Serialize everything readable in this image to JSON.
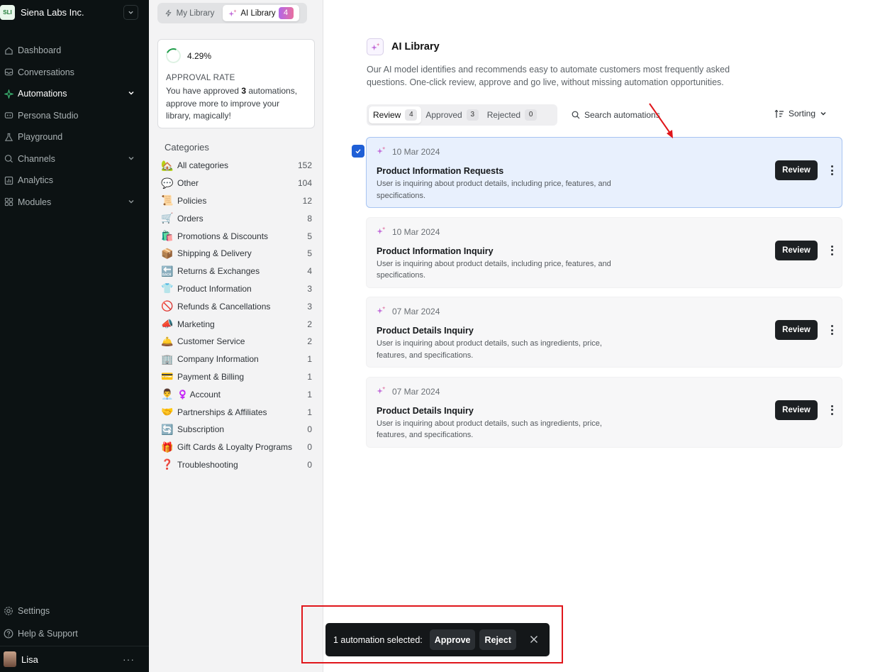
{
  "workspace": {
    "logo_text": "SLI",
    "name": "Siena Labs Inc."
  },
  "nav": {
    "items": [
      {
        "label": "Dashboard",
        "icon": "home-icon"
      },
      {
        "label": "Conversations",
        "icon": "inbox-icon"
      },
      {
        "label": "Automations",
        "icon": "sparkle-icon",
        "active": true,
        "expandable": true
      },
      {
        "label": "Persona Studio",
        "icon": "persona-icon"
      },
      {
        "label": "Playground",
        "icon": "flask-icon"
      },
      {
        "label": "Channels",
        "icon": "channels-icon",
        "expandable": true
      },
      {
        "label": "Analytics",
        "icon": "chart-icon"
      },
      {
        "label": "Modules",
        "icon": "grid-icon",
        "expandable": true
      }
    ],
    "bottom": [
      {
        "label": "Settings",
        "icon": "gear-icon"
      },
      {
        "label": "Help & Support",
        "icon": "help-icon"
      }
    ]
  },
  "user": {
    "name": "Lisa"
  },
  "library_toggle": {
    "my_library": "My Library",
    "ai_library": "AI Library",
    "ai_count": "4"
  },
  "approval": {
    "rate": "4.29%",
    "title": "APPROVAL RATE",
    "text_before": "You have approved ",
    "approved_count": "3",
    "text_after": " automations, approve more to improve your library, magically!"
  },
  "categories": {
    "heading": "Categories",
    "items": [
      {
        "emoji": "🏡",
        "label": "All categories",
        "count": "152"
      },
      {
        "emoji": "💬",
        "label": "Other",
        "count": "104"
      },
      {
        "emoji": "📜",
        "label": "Policies",
        "count": "12"
      },
      {
        "emoji": "🛒",
        "label": "Orders",
        "count": "8"
      },
      {
        "emoji": "🛍️",
        "label": " Promotions & Discounts",
        "count": "5"
      },
      {
        "emoji": "📦",
        "label": "Shipping & Delivery",
        "count": "5"
      },
      {
        "emoji": "🔙",
        "label": "Returns & Exchanges",
        "count": "4"
      },
      {
        "emoji": "👕",
        "label": "Product Information",
        "count": "3"
      },
      {
        "emoji": "🚫",
        "label": "Refunds & Cancellations",
        "count": "3"
      },
      {
        "emoji": "📣",
        "label": "Marketing",
        "count": "2"
      },
      {
        "emoji": "🛎️",
        "label": " Customer Service",
        "count": "2"
      },
      {
        "emoji": "🏢",
        "label": "Company Information",
        "count": "1"
      },
      {
        "emoji": "💳",
        "label": "Payment & Billing",
        "count": "1"
      },
      {
        "emoji": "👨‍💼",
        "label": "♀️ Account",
        "count": "1"
      },
      {
        "emoji": "🤝",
        "label": "Partnerships & Affiliates",
        "count": "1"
      },
      {
        "emoji": "🔄",
        "label": "Subscription",
        "count": "0"
      },
      {
        "emoji": "🎁",
        "label": "Gift Cards & Loyalty Programs",
        "count": "0"
      },
      {
        "emoji": "❓",
        "label": "Troubleshooting",
        "count": "0"
      }
    ]
  },
  "page": {
    "title": "AI Library",
    "description": "Our AI model identifies and recommends easy to automate customers most frequently asked questions. One-click review, approve and go live, without missing automation opportunities."
  },
  "status_tabs": [
    {
      "label": "Review",
      "count": "4",
      "active": true
    },
    {
      "label": "Approved",
      "count": "3"
    },
    {
      "label": "Rejected",
      "count": "0"
    }
  ],
  "search": {
    "placeholder": "Search automations"
  },
  "sorting": {
    "label": "Sorting"
  },
  "automations": [
    {
      "date": "10 Mar 2024",
      "title": "Product Information Requests",
      "description": "User is inquiring about product details, including price, features, and specifications.",
      "action": "Review",
      "selected": true
    },
    {
      "date": "10 Mar 2024",
      "title": "Product Information Inquiry",
      "description": "User is inquiring about product details, including price, features, and specifications.",
      "action": "Review"
    },
    {
      "date": "07 Mar 2024",
      "title": "Product Details Inquiry",
      "description": "User is inquiring about product details, such as ingredients, price, features, and specifications.",
      "action": "Review"
    },
    {
      "date": "07 Mar 2024",
      "title": "Product Details Inquiry",
      "description": "User is inquiring about product details, such as ingredients, price, features, and specifications.",
      "action": "Review"
    }
  ],
  "selection_bar": {
    "text": "1 automation selected:",
    "approve": "Approve",
    "reject": "Reject"
  },
  "colors": {
    "accent": "#1f5fd6",
    "annotation": "#e0161b",
    "sidebar_bg": "#0c1213"
  }
}
